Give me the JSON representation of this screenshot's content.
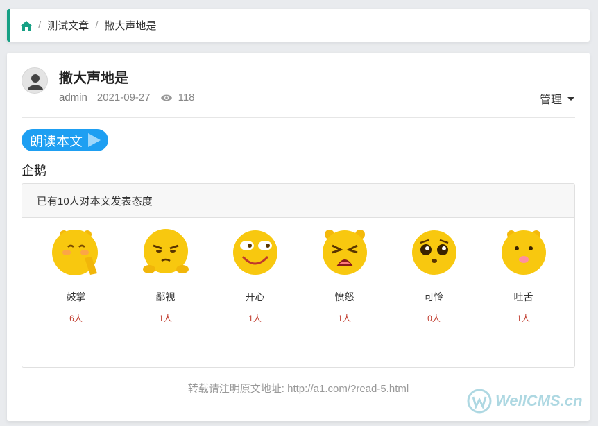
{
  "breadcrumb": {
    "items": [
      "测试文章",
      "撒大声地是"
    ],
    "separator": "/"
  },
  "article": {
    "title": "撒大声地是",
    "author": "admin",
    "date": "2021-09-27",
    "views": "118",
    "manage_label": "管理",
    "read_button_label": "朗读本文",
    "content": "企鹅"
  },
  "reactions": {
    "header": "已有10人对本文发表态度",
    "items": [
      {
        "label": "鼓掌",
        "count": "6人",
        "icon": "clap-emoji-icon"
      },
      {
        "label": "鄙视",
        "count": "1人",
        "icon": "disdain-emoji-icon"
      },
      {
        "label": "开心",
        "count": "1人",
        "icon": "happy-emoji-icon"
      },
      {
        "label": "愤怒",
        "count": "1人",
        "icon": "angry-emoji-icon"
      },
      {
        "label": "可怜",
        "count": "0人",
        "icon": "pitiful-emoji-icon"
      },
      {
        "label": "吐舌",
        "count": "1人",
        "icon": "tongue-emoji-icon"
      }
    ]
  },
  "reprint_note": "转载请注明原文地址: http://a1.com/?read-5.html",
  "watermark": "WellCMS.cn",
  "colors": {
    "accent": "#17a085",
    "button": "#1e9ff2",
    "count": "#c0392b"
  }
}
